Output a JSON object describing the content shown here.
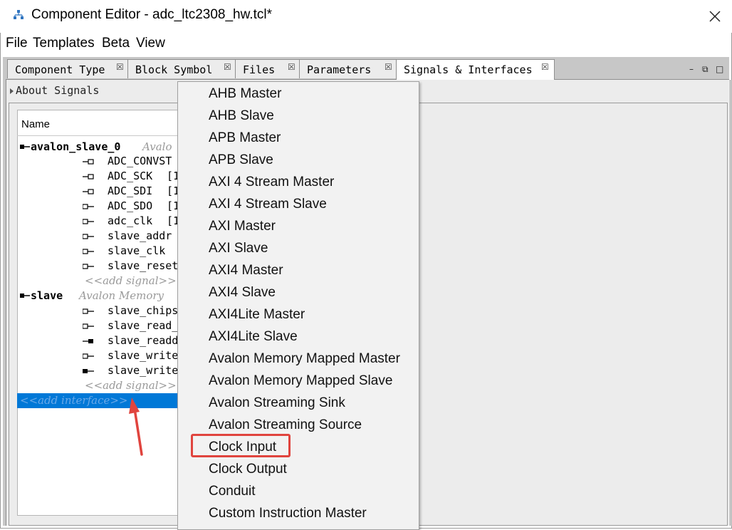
{
  "window": {
    "title": "Component Editor - adc_ltc2308_hw.tcl*",
    "close_glyph": "✕"
  },
  "menubar": [
    "File",
    "Templates",
    "Beta",
    "View"
  ],
  "tabs": [
    {
      "label": "Component Type",
      "close": "☒",
      "active": false
    },
    {
      "label": "Block Symbol",
      "close": "☒",
      "active": false
    },
    {
      "label": "Files",
      "close": "☒",
      "active": false
    },
    {
      "label": "Parameters",
      "close": "☒",
      "active": false
    },
    {
      "label": "Signals & Interfaces",
      "close": "☒",
      "active": true
    }
  ],
  "window_controls": {
    "minimize": "–",
    "restore": "⧉",
    "maximize": "□"
  },
  "about_section": "About Signals",
  "table": {
    "header_name": "Name",
    "interfaces": [
      {
        "name": "avalon_slave_0",
        "type": "Avalo",
        "signals": [
          {
            "name": "ADC_CONVST",
            "width": ""
          },
          {
            "name": "ADC_SCK",
            "width": "[1"
          },
          {
            "name": "ADC_SDI",
            "width": "[1"
          },
          {
            "name": "ADC_SDO",
            "width": "[1"
          },
          {
            "name": "adc_clk",
            "width": "[1"
          },
          {
            "name": "slave_addr",
            "width": ""
          },
          {
            "name": "slave_clk",
            "width": ""
          },
          {
            "name": "slave_reset",
            "width": ""
          }
        ],
        "add_signal": "<<add  signal>>"
      },
      {
        "name": "slave",
        "type": "Avalon  Memory",
        "signals": [
          {
            "name": "slave_chips",
            "width": ""
          },
          {
            "name": "slave_read_",
            "width": ""
          },
          {
            "name": "slave_readd",
            "width": ""
          },
          {
            "name": "slave_write",
            "width": ""
          },
          {
            "name": "slave_write",
            "width": ""
          }
        ],
        "add_signal": "<<add  signal>>"
      }
    ],
    "add_interface": "<<add  interface>>"
  },
  "dropdown": {
    "items": [
      "AHB Master",
      "AHB Slave",
      "APB Master",
      "APB Slave",
      "AXI 4 Stream Master",
      "AXI 4 Stream Slave",
      "AXI Master",
      "AXI Slave",
      "AXI4 Master",
      "AXI4 Slave",
      "AXI4Lite Master",
      "AXI4Lite Slave",
      "Avalon Memory Mapped Master",
      "Avalon Memory Mapped Slave",
      "Avalon Streaming Sink",
      "Avalon Streaming Source",
      "Clock Input",
      "Clock Output",
      "Conduit",
      "Custom Instruction Master"
    ],
    "highlighted": "Clock Input",
    "highlight_color": "#e0443e"
  },
  "colors": {
    "selection": "#0078d7",
    "annotation": "#e0443e"
  }
}
